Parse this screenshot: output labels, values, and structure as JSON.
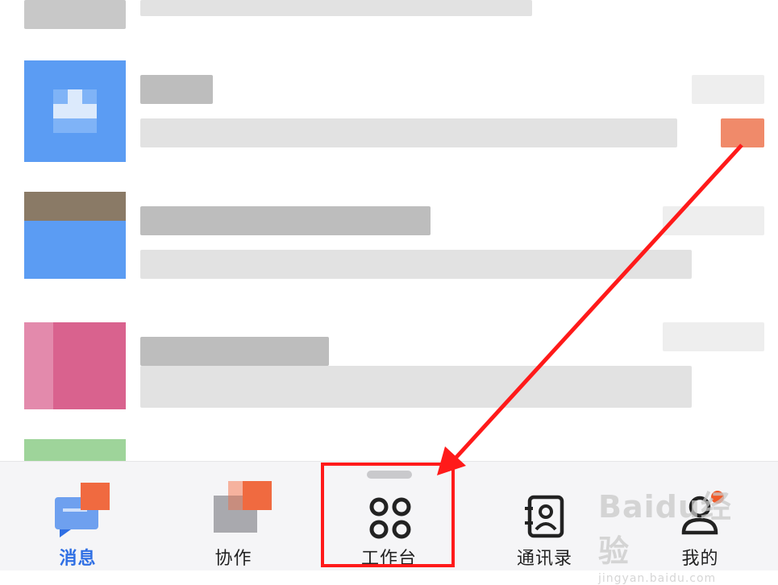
{
  "tabbar": {
    "tabs": [
      {
        "label": "消息",
        "icon": "message-icon",
        "active": true
      },
      {
        "label": "协作",
        "icon": "collaboration-icon",
        "active": false
      },
      {
        "label": "工作台",
        "icon": "workbench-grid-icon",
        "active": false
      },
      {
        "label": "通讯录",
        "icon": "contacts-icon",
        "active": false
      },
      {
        "label": "我的",
        "icon": "profile-icon",
        "active": false
      }
    ]
  },
  "watermark": {
    "brand": "Baidu经验",
    "url": "jingyan.baidu.com"
  },
  "colors": {
    "accent": "#2f6fe4",
    "highlight": "#ff1a1a",
    "badge": "#f05a28"
  }
}
